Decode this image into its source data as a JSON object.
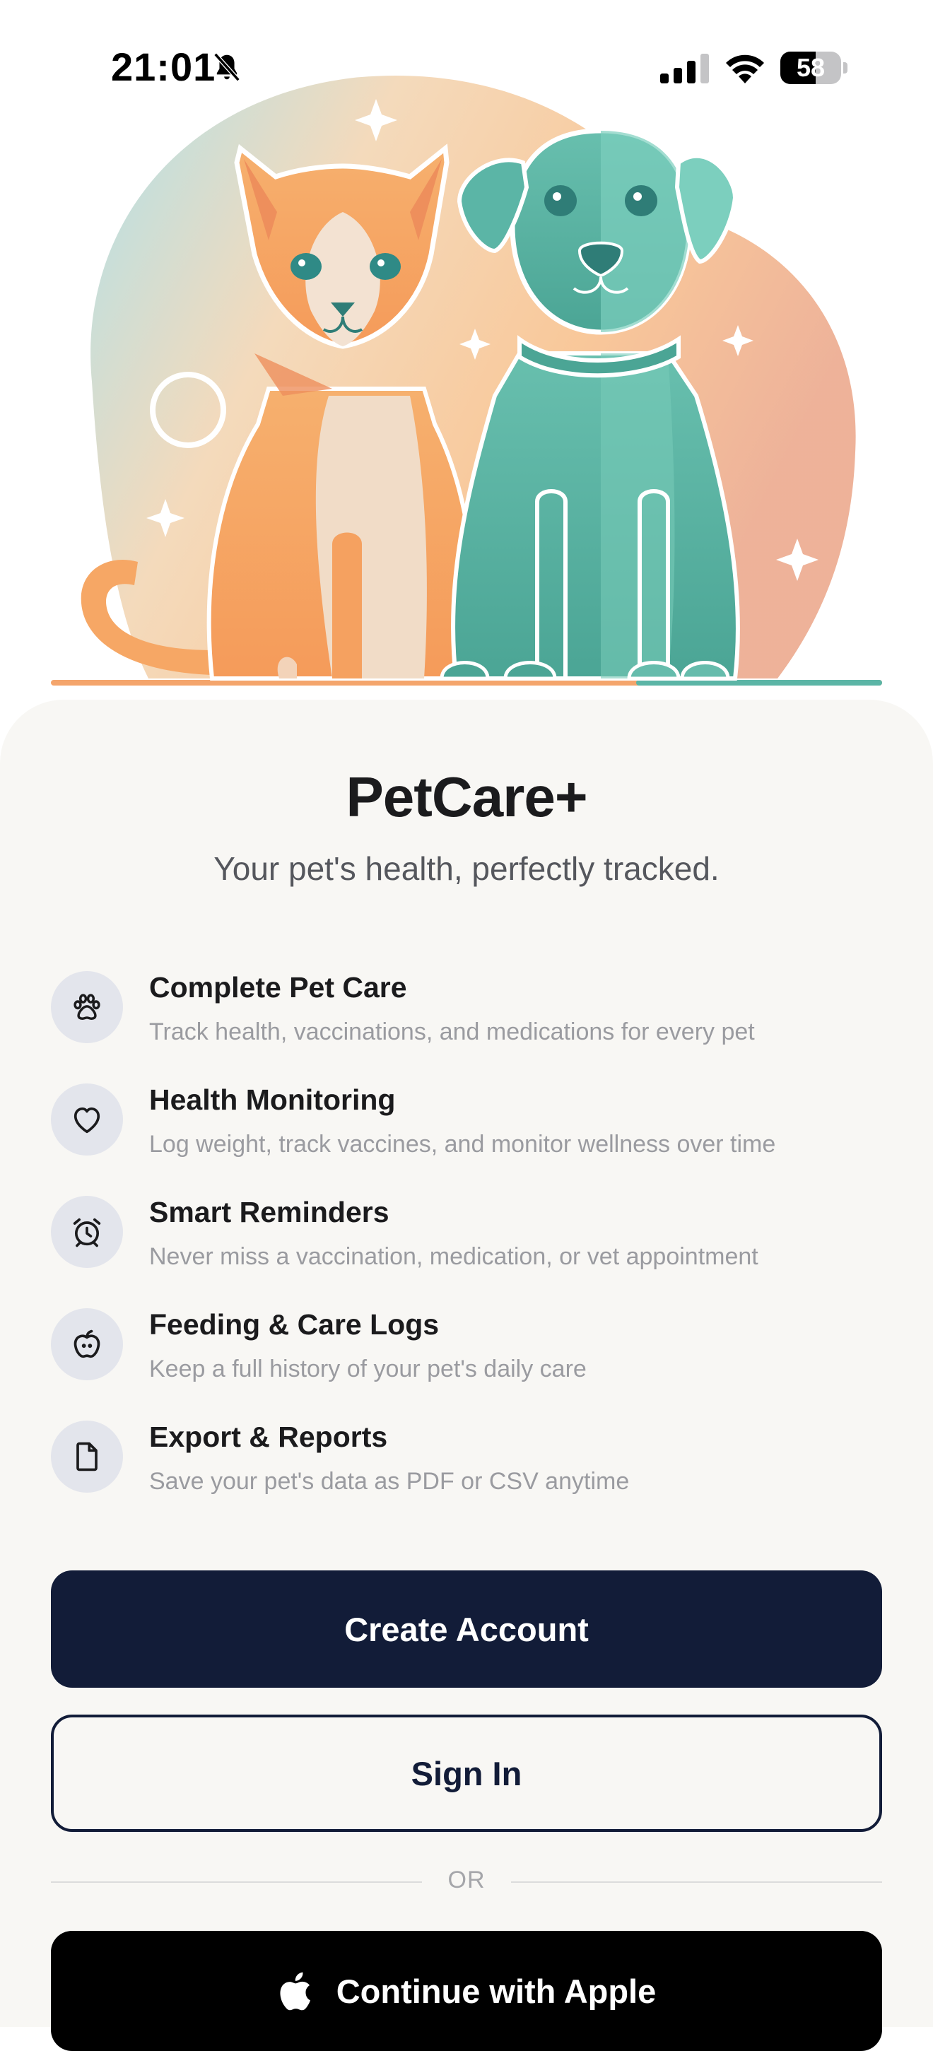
{
  "status_bar": {
    "time": "21:01",
    "battery": "58",
    "battery_level": 0.58,
    "icons": [
      "bell-slash-icon",
      "cellular-signal-icon",
      "wifi-icon",
      "battery-icon"
    ]
  },
  "hero": {
    "illustration": "cat-and-dog-illustration",
    "colors": {
      "cat": "#f5a766",
      "dog": "#5bb5a6",
      "sky_blue": "#a8dde6",
      "peach": "#f7c59a"
    }
  },
  "app": {
    "title": "PetCare+",
    "tagline": "Your pet's health, perfectly tracked."
  },
  "features": [
    {
      "icon": "paw-icon",
      "title": "Complete Pet Care",
      "subtitle": "Track health, vaccinations, and medications for every pet"
    },
    {
      "icon": "heart-icon",
      "title": "Health Monitoring",
      "subtitle": "Log weight, track vaccines, and monitor wellness over time"
    },
    {
      "icon": "alarm-clock-icon",
      "title": "Smart Reminders",
      "subtitle": "Never miss a vaccination, medication, or vet appointment"
    },
    {
      "icon": "apple-fruit-icon",
      "title": "Feeding & Care Logs",
      "subtitle": "Keep a full history of your pet's daily care"
    },
    {
      "icon": "document-icon",
      "title": "Export & Reports",
      "subtitle": "Save your pet's data as PDF or CSV anytime"
    }
  ],
  "actions": {
    "create_account": "Create Account",
    "sign_in": "Sign In",
    "divider": "OR",
    "apple": "Continue with Apple"
  },
  "colors": {
    "primary": "#121c38",
    "sheet_background": "#f8f7f4",
    "icon_circle": "#e3e5ec",
    "subtitle_gray": "#9a9ba0"
  }
}
